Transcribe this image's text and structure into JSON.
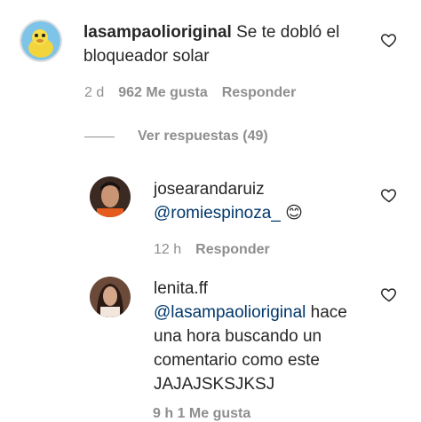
{
  "comments": [
    {
      "username": "lasampaolioriginal",
      "text": "Se te dobló el bloqueador solar",
      "time": "2 d",
      "likes": "962 Me gusta",
      "reply": "Responder"
    }
  ],
  "view_replies": "Ver respuestas (49)",
  "replies": [
    {
      "username": "josearandaruiz",
      "mention": "@romiespinoza_",
      "emoji": "😊",
      "time": "12 h",
      "reply": "Responder"
    },
    {
      "username": "lenita.ff",
      "mention": "@lasampaolioriginal",
      "text_line1": "hace",
      "text_line2": "una hora buscando un",
      "text_line3": "comentario como este",
      "text_line4": "JAJAJSKSJKSJ",
      "footer_partial": "9 h  1 Me gusta"
    }
  ],
  "colors": {
    "text": "#262626",
    "secondary": "#8e8e8e",
    "link": "#00376b"
  },
  "icons": [
    "heart-icon"
  ]
}
